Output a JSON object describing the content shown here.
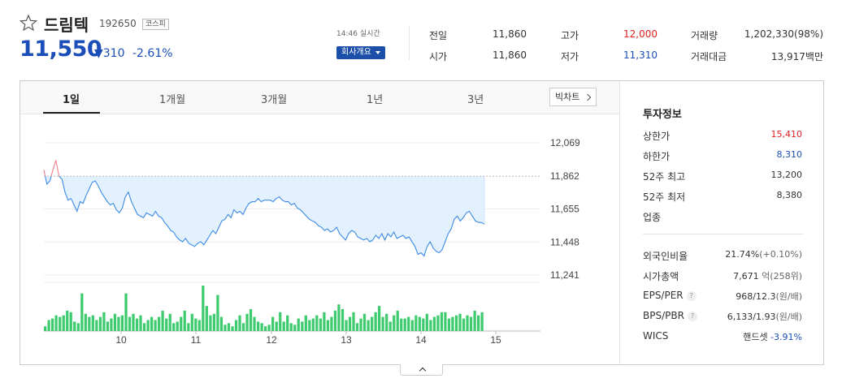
{
  "stock": {
    "name": "드림텍",
    "code": "192650",
    "market": "코스피",
    "price": "11,550",
    "change": "▼310",
    "change_pct": "-2.61%",
    "realtime": "14:46 실시간",
    "company_button": "회사개요"
  },
  "quote": {
    "prev_label": "전일",
    "prev": "11,860",
    "open_label": "시가",
    "open": "11,860",
    "high_label": "고가",
    "high": "12,000",
    "low_label": "저가",
    "low": "11,310",
    "volume_label": "거래량",
    "volume": "1,202,330(98%)",
    "amount_label": "거래대금",
    "amount": "13,917백만"
  },
  "tabs": [
    "1일",
    "1개월",
    "3개월",
    "1년",
    "3년"
  ],
  "big_chart_label": "빅차트",
  "investment": {
    "title": "투자정보",
    "upper_limit_label": "상한가",
    "upper_limit": "15,410",
    "lower_limit_label": "하한가",
    "lower_limit": "8,310",
    "high52_label": "52주 최고",
    "high52": "13,200",
    "low52_label": "52주 최저",
    "low52": "8,380",
    "sector_label": "업종",
    "foreign_label": "외국인비율",
    "foreign": "21.74%",
    "foreign_sub": "(+0.10%)",
    "cap_label": "시가총액",
    "cap": "7,671",
    "cap_unit": "억",
    "cap_sub": "(258위)",
    "eps_label": "EPS/PER",
    "eps": "968/12.3",
    "eps_unit": "(원/배)",
    "bps_label": "BPS/PBR",
    "bps": "6,133/1.93",
    "bps_unit": "(원/배)",
    "wics_label": "WICS",
    "wics": "핸드셋",
    "wics_change": "-3.91%"
  },
  "colors": {
    "up": "#e0201f",
    "down": "#1b4eb8",
    "volume": "#3ecb6e",
    "area": "#e3f0fd",
    "line": "#3b8be5"
  },
  "chart_data": {
    "type": "line",
    "title": "",
    "xlabel": "",
    "ylabel": "",
    "x_ticks": [
      "10",
      "11",
      "12",
      "13",
      "14",
      "15"
    ],
    "y_ticks": [
      "12,069",
      "11,862",
      "11,655",
      "11,448",
      "11,241"
    ],
    "ylim": [
      11241,
      12069
    ],
    "reference": 11860,
    "grid": true,
    "values": [
      11900,
      11810,
      11830,
      11900,
      11960,
      11860,
      11840,
      11760,
      11710,
      11720,
      11680,
      11640,
      11700,
      11690,
      11740,
      11780,
      11820,
      11830,
      11800,
      11760,
      11730,
      11700,
      11680,
      11690,
      11650,
      11630,
      11660,
      11730,
      11760,
      11700,
      11660,
      11620,
      11610,
      11600,
      11630,
      11620,
      11610,
      11640,
      11610,
      11600,
      11570,
      11550,
      11520,
      11510,
      11480,
      11460,
      11450,
      11470,
      11440,
      11430,
      11420,
      11440,
      11450,
      11430,
      11460,
      11490,
      11520,
      11500,
      11540,
      11580,
      11590,
      11620,
      11600,
      11650,
      11630,
      11640,
      11620,
      11660,
      11690,
      11700,
      11700,
      11720,
      11700,
      11710,
      11710,
      11710,
      11700,
      11720,
      11730,
      11710,
      11700,
      11700,
      11680,
      11690,
      11660,
      11650,
      11630,
      11610,
      11590,
      11580,
      11570,
      11550,
      11540,
      11520,
      11530,
      11510,
      11520,
      11540,
      11500,
      11480,
      11460,
      11500,
      11520,
      11510,
      11480,
      11470,
      11460,
      11470,
      11450,
      11460,
      11490,
      11470,
      11500,
      11460,
      11500,
      11480,
      11510,
      11470,
      11480,
      11490,
      11470,
      11480,
      11450,
      11420,
      11370,
      11380,
      11360,
      11420,
      11450,
      11410,
      11390,
      11380,
      11400,
      11450,
      11500,
      11530,
      11590,
      11610,
      11580,
      11600,
      11630,
      11640,
      11610,
      11580,
      11570,
      11570,
      11560
    ],
    "volume": [
      3,
      7,
      8,
      10,
      9,
      10,
      13,
      12,
      6,
      5,
      24,
      11,
      9,
      10,
      7,
      9,
      12,
      6,
      8,
      11,
      9,
      10,
      24,
      9,
      11,
      8,
      10,
      5,
      7,
      9,
      7,
      9,
      13,
      8,
      11,
      5,
      6,
      9,
      13,
      5,
      11,
      8,
      7,
      29,
      16,
      10,
      11,
      23,
      9,
      4,
      5,
      3,
      7,
      10,
      5,
      11,
      14,
      9,
      6,
      5,
      3,
      4,
      9,
      6,
      12,
      6,
      10,
      5,
      4,
      8,
      6,
      10,
      7,
      8,
      10,
      8,
      12,
      7,
      9,
      13,
      17,
      14,
      7,
      9,
      12,
      5,
      8,
      11,
      7,
      9,
      12,
      16,
      9,
      11,
      6,
      10,
      13,
      8,
      8,
      9,
      7,
      10,
      9,
      8,
      11,
      7,
      9,
      10,
      12,
      12,
      8,
      9,
      10,
      11,
      8,
      10,
      9,
      13,
      10,
      12
    ]
  }
}
